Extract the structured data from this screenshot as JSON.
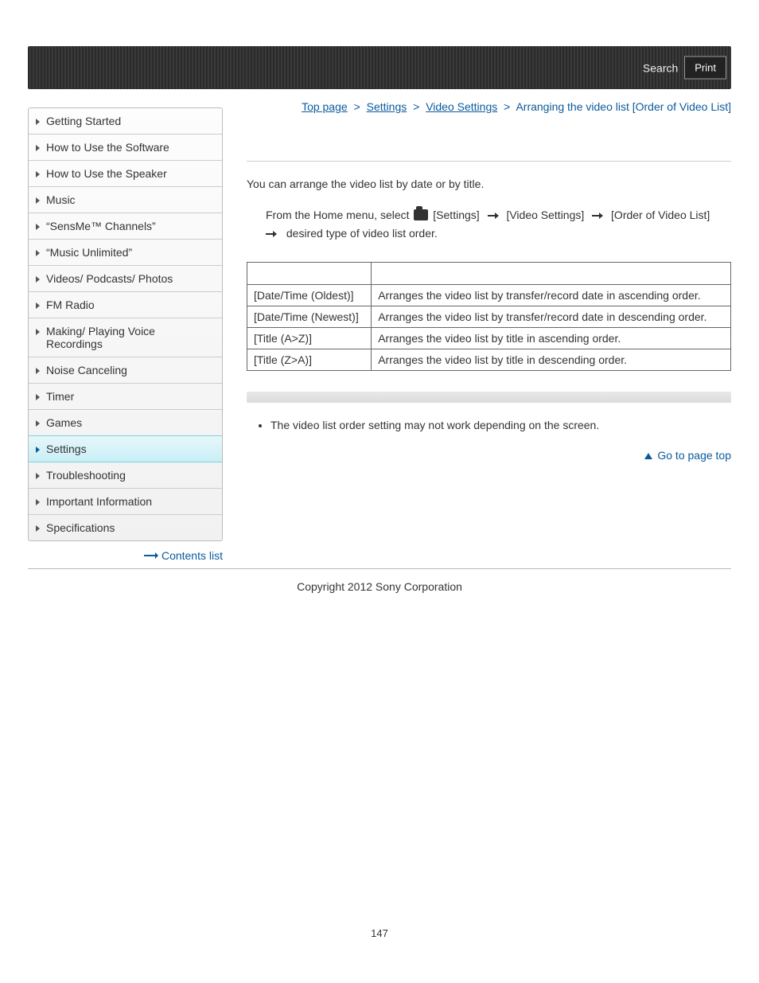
{
  "header": {
    "search": "Search",
    "print": "Print"
  },
  "sidebar": {
    "items": [
      "Getting Started",
      "How to Use the Software",
      "How to Use the Speaker",
      "Music",
      "“SensMe™ Channels”",
      "“Music Unlimited”",
      "Videos/ Podcasts/ Photos",
      "FM Radio",
      "Making/ Playing Voice Recordings",
      "Noise Canceling",
      "Timer",
      "Games",
      "Settings",
      "Troubleshooting",
      "Important Information",
      "Specifications"
    ],
    "active_index": 12,
    "contents_list": "Contents list"
  },
  "breadcrumb": {
    "top": "Top page",
    "settings": "Settings",
    "video_settings": "Video Settings",
    "current": "Arranging the video list [Order of Video List]",
    "sep": ">"
  },
  "content": {
    "intro": "You can arrange the video list by date or by title.",
    "step_prefix": "From the Home menu, select",
    "step_settings": "[Settings]",
    "step_video": "[Video Settings]",
    "step_order": "[Order of Video List]",
    "step_suffix": "desired type of video list order.",
    "table": {
      "headers": [
        "",
        ""
      ],
      "rows": [
        [
          "[Date/Time (Oldest)]",
          "Arranges the video list by transfer/record date in ascending order."
        ],
        [
          "[Date/Time (Newest)]",
          "Arranges the video list by transfer/record date in descending order."
        ],
        [
          "[Title (A>Z)]",
          "Arranges the video list by title in ascending order."
        ],
        [
          "[Title (Z>A)]",
          "Arranges the video list by title in descending order."
        ]
      ]
    },
    "note": "The video list order setting may not work depending on the screen.",
    "go_top": "Go to page top"
  },
  "footer": {
    "copyright": "Copyright 2012 Sony Corporation",
    "page_number": "147"
  }
}
